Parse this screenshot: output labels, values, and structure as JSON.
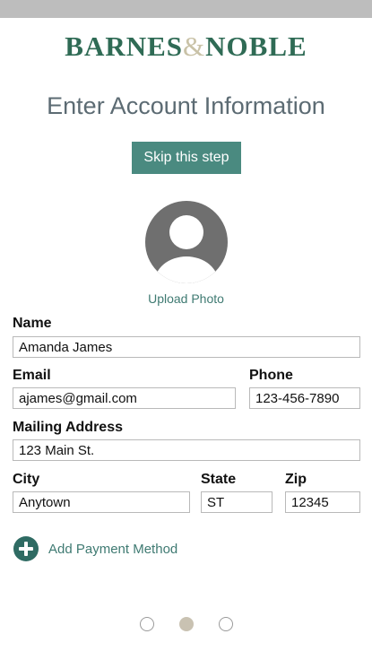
{
  "brand": {
    "left": "BARNES",
    "amp": "&",
    "right": "NOBLE"
  },
  "title": "Enter Account Information",
  "skip_label": "Skip this step",
  "upload_label": "Upload Photo",
  "fields": {
    "name": {
      "label": "Name",
      "value": "Amanda James"
    },
    "email": {
      "label": "Email",
      "value": "ajames@gmail.com"
    },
    "phone": {
      "label": "Phone",
      "value": "123-456-7890"
    },
    "address": {
      "label": "Mailing Address",
      "value": "123 Main St."
    },
    "city": {
      "label": "City",
      "value": "Anytown"
    },
    "state": {
      "label": "State",
      "value": "ST"
    },
    "zip": {
      "label": "Zip",
      "value": "12345"
    }
  },
  "add_payment_label": "Add Payment Method",
  "pager": {
    "total": 3,
    "active": 2
  },
  "colors": {
    "brand_green": "#2f6b55",
    "button_teal": "#4a8a80",
    "link_teal": "#3f7a72",
    "status_bar": "#bdbdbd"
  }
}
